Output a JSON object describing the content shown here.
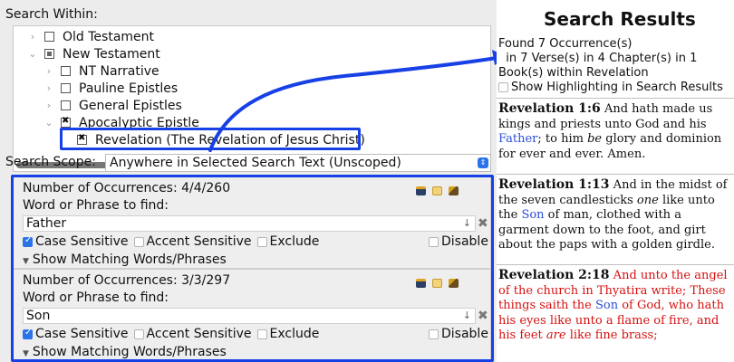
{
  "left": {
    "search_within_label": "Search Within:",
    "tree": [
      {
        "label": "Old Testament",
        "chevron": "›",
        "check": "none",
        "indent": 0
      },
      {
        "label": "New Testament",
        "chevron": "⌄",
        "check": "partial",
        "indent": 0
      },
      {
        "label": "NT Narrative",
        "chevron": "›",
        "check": "none",
        "indent": 1
      },
      {
        "label": "Pauline Epistles",
        "chevron": "›",
        "check": "none",
        "indent": 1
      },
      {
        "label": "General Epistles",
        "chevron": "›",
        "check": "none",
        "indent": 1
      },
      {
        "label": "Apocalyptic Epistle",
        "chevron": "⌄",
        "check": "checked",
        "indent": 1
      },
      {
        "label": "Revelation (The Revelation of Jesus Christ)",
        "chevron": "",
        "check": "checked",
        "indent": 2
      }
    ],
    "scope_label": "Search Scope:",
    "scope_value": "Anywhere in Selected Search Text (Unscoped)",
    "terms": [
      {
        "occurrences": "Number of Occurrences: 4/4/260",
        "word_label": "Word or Phrase to find:",
        "value": "Father",
        "case_sensitive": "Case Sensitive",
        "accent_sensitive": "Accent Sensitive",
        "exclude": "Exclude",
        "disable": "Disable",
        "show_matching": "Show Matching Words/Phrases"
      },
      {
        "occurrences": "Number of Occurrences: 3/3/297",
        "word_label": "Word or Phrase to find:",
        "value": "Son",
        "case_sensitive": "Case Sensitive",
        "accent_sensitive": "Accent Sensitive",
        "exclude": "Exclude",
        "disable": "Disable",
        "show_matching": "Show Matching Words/Phrases"
      }
    ]
  },
  "right": {
    "title": "Search Results",
    "found_line1": "Found 7 Occurrence(s)",
    "found_line2": "  in 7 Verse(s) in 4 Chapter(s) in 1 Book(s) within Revelation",
    "show_highlighting": "Show Highlighting in Search Results",
    "verses": [
      {
        "ref": "Revelation 1:6",
        "parts": [
          {
            "t": " And hath made us kings and priests unto God and his ",
            "c": ""
          },
          {
            "t": "Father",
            "c": "blue"
          },
          {
            "t": "; to him ",
            "c": ""
          },
          {
            "t": "be",
            "c": "i"
          },
          {
            "t": " glory and dominion for ever and ever. Amen.",
            "c": ""
          }
        ]
      },
      {
        "ref": "Revelation 1:13",
        "parts": [
          {
            "t": " And in the midst of the seven candlesticks ",
            "c": ""
          },
          {
            "t": "one",
            "c": "i"
          },
          {
            "t": " like unto the ",
            "c": ""
          },
          {
            "t": "Son",
            "c": "blue"
          },
          {
            "t": " of man, clothed with a garment down to the foot, and girt about the paps with a golden girdle.",
            "c": ""
          }
        ]
      },
      {
        "ref": "Revelation 2:18",
        "parts": [
          {
            "t": " And unto the angel of the church in Thyatira write; These things saith the ",
            "c": "red"
          },
          {
            "t": "Son",
            "c": "blue"
          },
          {
            "t": " of God, who hath his eyes like unto a flame of fire, and his feet ",
            "c": "red"
          },
          {
            "t": "are",
            "c": "red i"
          },
          {
            "t": " like fine brass;",
            "c": "red"
          }
        ]
      }
    ]
  },
  "colors": {
    "highlight_outline": "#1740e6",
    "checkbox_blue": "#2a73e8",
    "search_hit": "#2a4fd6",
    "words_of_christ": "#d51111"
  }
}
